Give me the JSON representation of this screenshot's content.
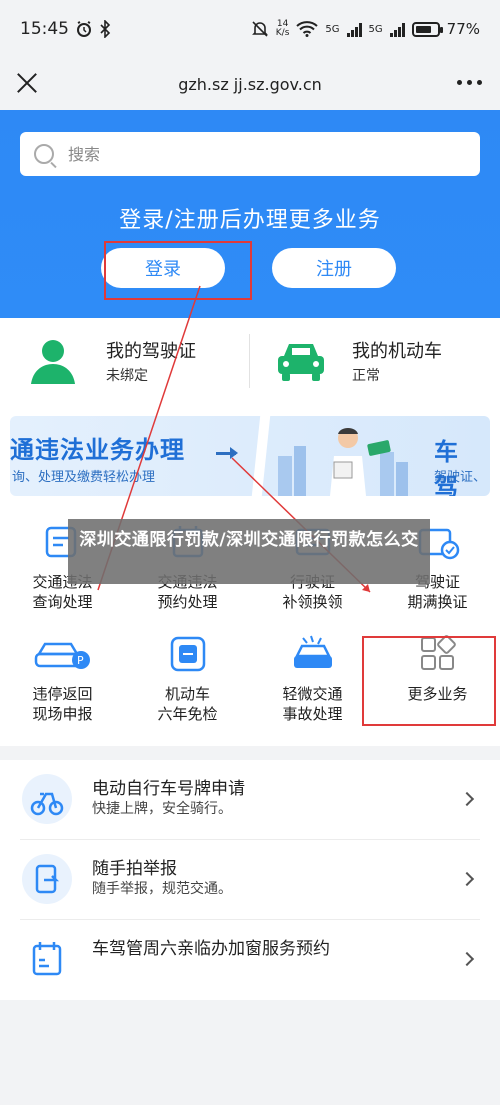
{
  "status_bar": {
    "time": "15:45",
    "speed_top": "14",
    "speed_bottom": "K/s",
    "network": "5G",
    "battery": "77%",
    "battery_level": 0.77
  },
  "nav": {
    "url": "gzh.sz jj.sz.gov.cn"
  },
  "search": {
    "placeholder": "搜索"
  },
  "hero": {
    "prompt": "登录/注册后办理更多业务",
    "login_label": "登录",
    "register_label": "注册"
  },
  "cards": {
    "license": {
      "title": "我的驾驶证",
      "status": "未绑定"
    },
    "vehicle": {
      "title": "我的机动车",
      "status": "正常"
    }
  },
  "banner": {
    "title": "通违法业务办理",
    "subtitle": "询、处理及缴费轻松办理",
    "right_title": "车 驾",
    "right_subtitle": "驾驶证、"
  },
  "overlay": {
    "text": "深圳交通限行罚款/深圳交通限行罚款怎么交"
  },
  "grid": [
    {
      "line1": "交通违法",
      "line2": "查询处理",
      "icon": "traffic-violation-icon"
    },
    {
      "line1": "交通违法",
      "line2": "预约处理",
      "icon": "appointment-icon"
    },
    {
      "line1": "行驶证",
      "line2": "补领换领",
      "icon": "vehicle-license-icon"
    },
    {
      "line1": "驾驶证",
      "line2": "期满换证",
      "icon": "driver-license-icon"
    },
    {
      "line1": "违停返回",
      "line2": "现场申报",
      "icon": "parking-return-icon"
    },
    {
      "line1": "机动车",
      "line2": "六年免检",
      "icon": "exempt-icon"
    },
    {
      "line1": "轻微交通",
      "line2": "事故处理",
      "icon": "accident-icon"
    },
    {
      "line1": "更多业务",
      "line2": "",
      "icon": "more-services-icon"
    }
  ],
  "list": [
    {
      "title": "电动自行车号牌申请",
      "desc": "快捷上牌，安全骑行。",
      "icon": "ebike-icon"
    },
    {
      "title": "随手拍举报",
      "desc": "随手举报，规范交通。",
      "icon": "photo-report-icon"
    },
    {
      "title": "车驾管周六亲临办加窗服务预约",
      "desc": "",
      "icon": "calendar-icon"
    }
  ],
  "colors": {
    "brand_blue": "#2e89f5",
    "icon_green": "#1db36b",
    "annotation_red": "#e03a3a"
  }
}
